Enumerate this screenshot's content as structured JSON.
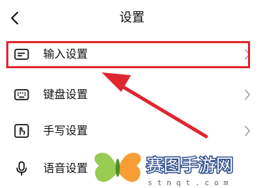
{
  "header": {
    "title": "设置"
  },
  "settings": [
    {
      "label": "输入设置",
      "icon": "keyboard-input-icon"
    },
    {
      "label": "键盘设置",
      "icon": "keyboard-icon"
    },
    {
      "label": "手写设置",
      "icon": "handwriting-icon"
    },
    {
      "label": "语音设置",
      "icon": "microphone-icon"
    }
  ],
  "watermark": {
    "text": "赛图手游网",
    "sub": "stnqt.com"
  },
  "colors": {
    "highlight": "#e0262e",
    "watermark_stroke": "#2f4e8c",
    "logo_green": "#8dc63f",
    "logo_orange": "#f7931e"
  }
}
